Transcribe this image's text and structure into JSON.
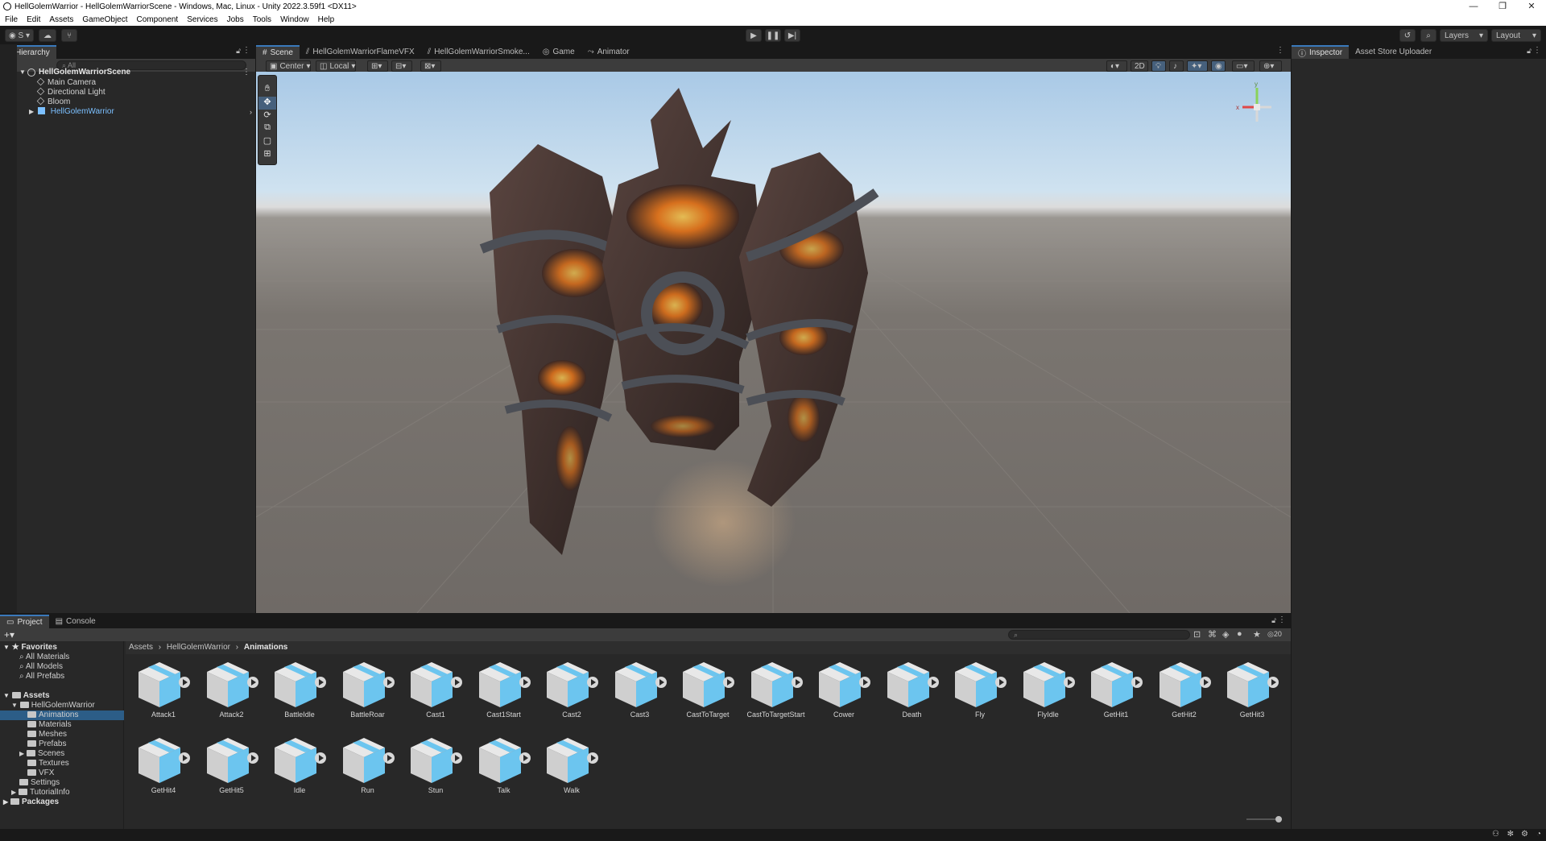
{
  "window": {
    "title": "HellGolemWarrior - HellGolemWarriorScene - Windows, Mac, Linux - Unity 2022.3.59f1 <DX11>",
    "controls": [
      "—",
      "❐",
      "✕"
    ]
  },
  "menu": [
    "File",
    "Edit",
    "Assets",
    "GameObject",
    "Component",
    "Services",
    "Jobs",
    "Tools",
    "Window",
    "Help"
  ],
  "toolbar": {
    "account_label": "S",
    "layers_label": "Layers",
    "layout_label": "Layout"
  },
  "hierarchy": {
    "tab": "Hierarchy",
    "search_placeholder": "All",
    "scene": "HellGolemWarriorScene",
    "items": [
      "Main Camera",
      "Directional Light",
      "Bloom",
      "HellGolemWarrior"
    ]
  },
  "scene_tabs": [
    "Scene",
    "HellGolemWarriorFlameVFX",
    "HellGolemWarriorSmoke...",
    "Game",
    "Animator"
  ],
  "scene_toolbar": {
    "pivot": "Center",
    "space": "Local",
    "mode_2d": "2D"
  },
  "gizmo": {
    "y": "y",
    "x": "x"
  },
  "inspector_tabs": [
    "Inspector",
    "Asset Store Uploader"
  ],
  "project": {
    "tabs": [
      "Project",
      "Console"
    ],
    "hidden_count": "20",
    "breadcrumb": [
      "Assets",
      "HellGolemWarrior",
      "Animations"
    ],
    "favorites": {
      "label": "Favorites",
      "items": [
        "All Materials",
        "All Models",
        "All Prefabs"
      ]
    },
    "tree": {
      "assets_label": "Assets",
      "root": "HellGolemWarrior",
      "folders": [
        "Animations",
        "Materials",
        "Meshes",
        "Prefabs",
        "Scenes",
        "Textures",
        "VFX"
      ],
      "others": [
        "Settings",
        "TutorialInfo"
      ],
      "packages": "Packages"
    },
    "assets": [
      "Attack1",
      "Attack2",
      "BattleIdle",
      "BattleRoar",
      "Cast1",
      "Cast1Start",
      "Cast2",
      "Cast3",
      "CastToTarget",
      "CastToTargetStart",
      "Cower",
      "Death",
      "Fly",
      "FlyIdle",
      "GetHit1",
      "GetHit2",
      "GetHit3",
      "GetHit4",
      "GetHit5",
      "Idle",
      "Run",
      "Stun",
      "Talk",
      "Walk"
    ]
  },
  "colors": {
    "accent": "#3a79bb",
    "prefab_blue": "#7cc0ff",
    "asset_cube": "#6cc5ef",
    "selection": "#2c5d87"
  }
}
